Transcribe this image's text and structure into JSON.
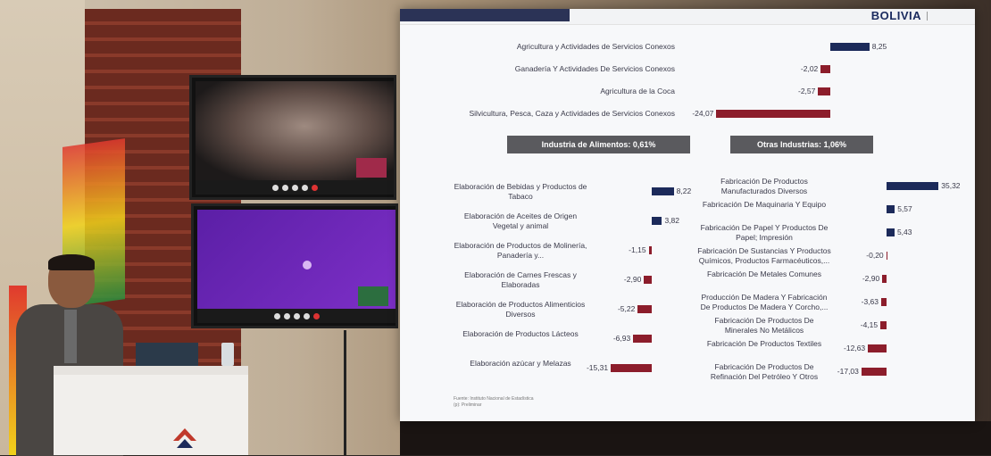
{
  "slide": {
    "brand": "BOLIVIA",
    "source_note": [
      "Fuente: Instituto Nacional de Estadística",
      "(p): Preliminar"
    ],
    "top_section": [
      {
        "label": "Agricultura y Actividades de Servicios Conexos",
        "value": "8,25",
        "v": 8.25
      },
      {
        "label": "Ganadería Y Actividades De Servicios Conexos",
        "value": "-2,02",
        "v": -2.02
      },
      {
        "label": "Agricultura de la Coca",
        "value": "-2,57",
        "v": -2.57
      },
      {
        "label": "Silvicultura, Pesca, Caza y Actividades de Servicios Conexos",
        "value": "-24,07",
        "v": -24.07
      }
    ],
    "left_header": "Industria de Alimentos: 0,61%",
    "right_header": "Otras Industrias: 1,06%",
    "left_items": [
      {
        "label": "Elaboración de Bebidas y Productos de Tabaco",
        "value": "8,22",
        "v": 8.22
      },
      {
        "label": "Elaboración de Aceites de Origen Vegetal y animal",
        "value": "3,82",
        "v": 3.82
      },
      {
        "label": "Elaboración de Productos de Molinería, Panadería y...",
        "value": "-1,15",
        "v": -1.15
      },
      {
        "label": "Elaboración de Carnes Frescas y Elaboradas",
        "value": "-2,90",
        "v": -2.9
      },
      {
        "label": "Elaboración de Productos Alimenticios Diversos",
        "value": "-5,22",
        "v": -5.22
      },
      {
        "label": "Elaboración de Productos Lácteos",
        "value": "-6,93",
        "v": -6.93
      },
      {
        "label": "Elaboración azúcar y Melazas",
        "value": "-15,31",
        "v": -15.31
      }
    ],
    "right_items": [
      {
        "label": "Fabricación De Productos Manufacturados Diversos",
        "value": "35,32",
        "v": 35.32
      },
      {
        "label": "Fabricación De Maquinaria Y Equipo",
        "value": "5,57",
        "v": 5.57
      },
      {
        "label": "Fabricación De Papel Y Productos De Papel; Impresión",
        "value": "5,43",
        "v": 5.43
      },
      {
        "label": "Fabricación De Sustancias Y Productos Químicos, Productos Farmacéuticos,...",
        "value": "-0,20",
        "v": -0.2
      },
      {
        "label": "Fabricación De Metales Comunes",
        "value": "-2,90",
        "v": -2.9
      },
      {
        "label": "Producción De Madera Y Fabricación De Productos De Madera Y Corcho,...",
        "value": "-3,63",
        "v": -3.63
      },
      {
        "label": "Fabricación De Productos De Minerales No Metálicos",
        "value": "-4,15",
        "v": -4.15
      },
      {
        "label": "Fabricación De Productos Textiles",
        "value": "-12,63",
        "v": -12.63
      },
      {
        "label": "Fabricación De Productos De Refinación Del Petróleo Y Otros",
        "value": "-17,03",
        "v": -17.03
      }
    ]
  },
  "colors": {
    "positive": "#1c2a5a",
    "negative": "#8c1d2b",
    "header": "#5a5a5e"
  }
}
